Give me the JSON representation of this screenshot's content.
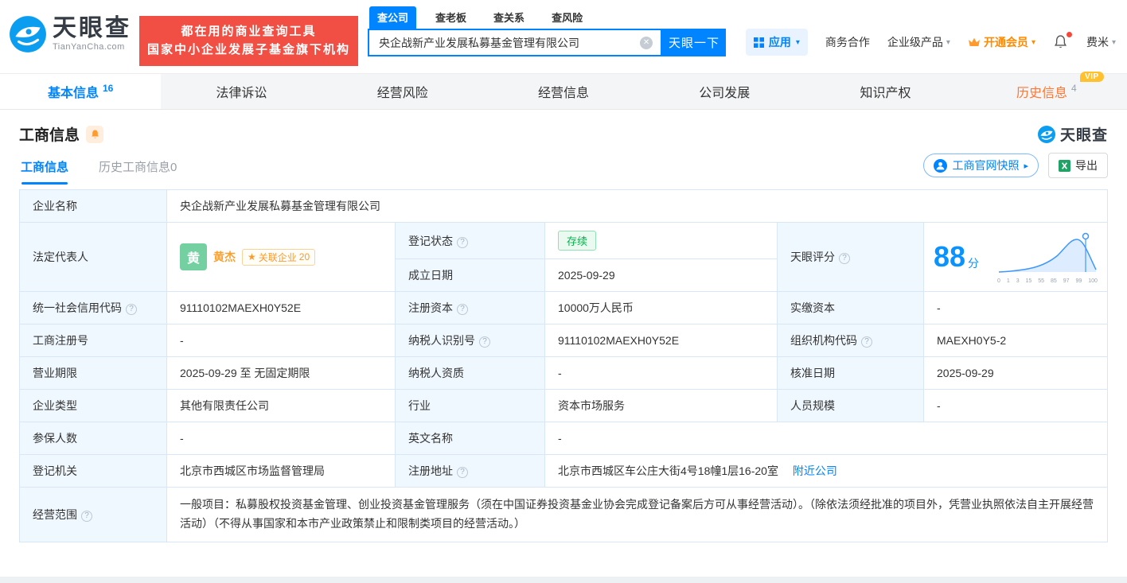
{
  "header": {
    "logo": {
      "title": "天眼查",
      "subtitle": "TianYanCha.com"
    },
    "slogan": {
      "line1": "都在用的商业查询工具",
      "line2": "国家中小企业发展子基金旗下机构"
    },
    "search": {
      "tabs": [
        {
          "label": "查公司"
        },
        {
          "label": "查老板"
        },
        {
          "label": "查关系"
        },
        {
          "label": "查风险"
        }
      ],
      "value": "央企战新产业发展私募基金管理有限公司",
      "button": "天眼一下"
    },
    "nav": {
      "apps": "应用",
      "cooperation": "商务合作",
      "enterprise": "企业级产品",
      "vip": "开通会员",
      "user": "费米"
    }
  },
  "main_tabs": [
    {
      "label": "基本信息",
      "count": "16"
    },
    {
      "label": "法律诉讼"
    },
    {
      "label": "经营风险"
    },
    {
      "label": "经营信息"
    },
    {
      "label": "公司发展"
    },
    {
      "label": "知识产权"
    },
    {
      "label": "历史信息",
      "count": "4",
      "vip": "VIP"
    }
  ],
  "section": {
    "title": "工商信息",
    "brand": "天眼查"
  },
  "subtabs": {
    "current": "工商信息",
    "history": "历史工商信息0",
    "snapshot_button": "工商官网快照",
    "export_button": "导出"
  },
  "table": {
    "company_name": {
      "label": "企业名称",
      "value": "央企战新产业发展私募基金管理有限公司"
    },
    "legal_rep": {
      "label": "法定代表人",
      "avatar": "黄",
      "name": "黄杰",
      "related_label": "关联企业",
      "related_count": "20"
    },
    "reg_status": {
      "label": "登记状态",
      "value": "存续"
    },
    "establish_date": {
      "label": "成立日期",
      "value": "2025-09-29"
    },
    "score": {
      "label": "天眼评分",
      "value": "88",
      "unit": "分",
      "axis_labels": [
        "0",
        "1",
        "3",
        "15",
        "55",
        "85",
        "97",
        "99",
        "100"
      ]
    },
    "credit_code": {
      "label": "统一社会信用代码",
      "value": "91110102MAEXH0Y52E"
    },
    "reg_capital": {
      "label": "注册资本",
      "value": "10000万人民币"
    },
    "paid_capital": {
      "label": "实缴资本",
      "value": "-"
    },
    "reg_number": {
      "label": "工商注册号",
      "value": "-"
    },
    "taxpayer_id": {
      "label": "纳税人识别号",
      "value": "91110102MAEXH0Y52E"
    },
    "org_code": {
      "label": "组织机构代码",
      "value": "MAEXH0Y5-2"
    },
    "business_term": {
      "label": "营业期限",
      "value": "2025-09-29 至 无固定期限"
    },
    "taxpayer_qualification": {
      "label": "纳税人资质",
      "value": "-"
    },
    "approval_date": {
      "label": "核准日期",
      "value": "2025-09-29"
    },
    "company_type": {
      "label": "企业类型",
      "value": "其他有限责任公司"
    },
    "industry": {
      "label": "行业",
      "value": "资本市场服务"
    },
    "staff_size": {
      "label": "人员规模",
      "value": "-"
    },
    "insured_count": {
      "label": "参保人数",
      "value": "-"
    },
    "english_name": {
      "label": "英文名称",
      "value": "-"
    },
    "reg_authority": {
      "label": "登记机关",
      "value": "北京市西城区市场监督管理局"
    },
    "reg_address": {
      "label": "注册地址",
      "value": "北京市西城区车公庄大街4号18幢1层16-20室",
      "nearby_link": "附近公司"
    },
    "business_scope": {
      "label": "经营范围",
      "value": "一般项目：私募股权投资基金管理、创业投资基金管理服务（须在中国证券投资基金业协会完成登记备案后方可从事经营活动）。（除依法须经批准的项目外，凭营业执照依法自主开展经营活动）（不得从事国家和本市产业政策禁止和限制类项目的经营活动。）"
    }
  },
  "icons": {
    "caret_down": "▾",
    "caret_right": "▸",
    "help": "?",
    "clear": "✕",
    "medal": "★"
  },
  "colors": {
    "brand_blue": "#0084ff",
    "slogan_red": "#f14e44",
    "vip_orange": "#ff8a00",
    "history_orange": "#ff7733",
    "status_green": "#00b34a",
    "label_cell_bg": "#f0f8ff"
  }
}
